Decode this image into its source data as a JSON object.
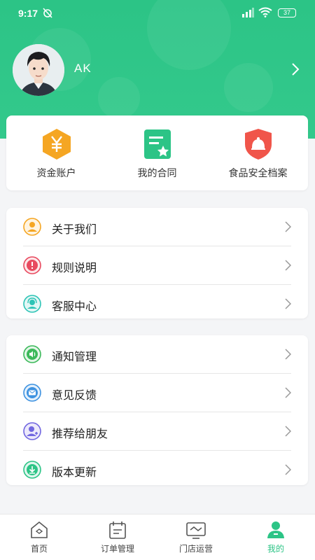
{
  "status_bar": {
    "time": "9:17",
    "battery": "37"
  },
  "profile": {
    "username": "AK"
  },
  "quick_actions": [
    {
      "label": "资金账户",
      "icon": "yuan-icon",
      "color": "#f5a623"
    },
    {
      "label": "我的合同",
      "icon": "contract-icon",
      "color": "#2cc486"
    },
    {
      "label": "食品安全档案",
      "icon": "food-safety-icon",
      "color": "#f0554a"
    }
  ],
  "menu_group_1": [
    {
      "label": "关于我们",
      "icon": "about-us-icon"
    },
    {
      "label": "规则说明",
      "icon": "rules-icon"
    },
    {
      "label": "客服中心",
      "icon": "customer-service-icon"
    }
  ],
  "menu_group_2": [
    {
      "label": "通知管理",
      "icon": "notification-icon"
    },
    {
      "label": "意见反馈",
      "icon": "feedback-icon"
    },
    {
      "label": "推荐给朋友",
      "icon": "recommend-icon"
    },
    {
      "label": "版本更新",
      "icon": "update-icon"
    }
  ],
  "tabbar": [
    {
      "label": "首页",
      "icon": "home-icon",
      "active": false
    },
    {
      "label": "订单管理",
      "icon": "orders-icon",
      "active": false
    },
    {
      "label": "门店运营",
      "icon": "store-operation-icon",
      "active": false
    },
    {
      "label": "我的",
      "icon": "profile-icon",
      "active": true
    }
  ],
  "colors": {
    "brand": "#2cc486",
    "accent_orange": "#f5a623",
    "accent_red": "#f0554a"
  }
}
